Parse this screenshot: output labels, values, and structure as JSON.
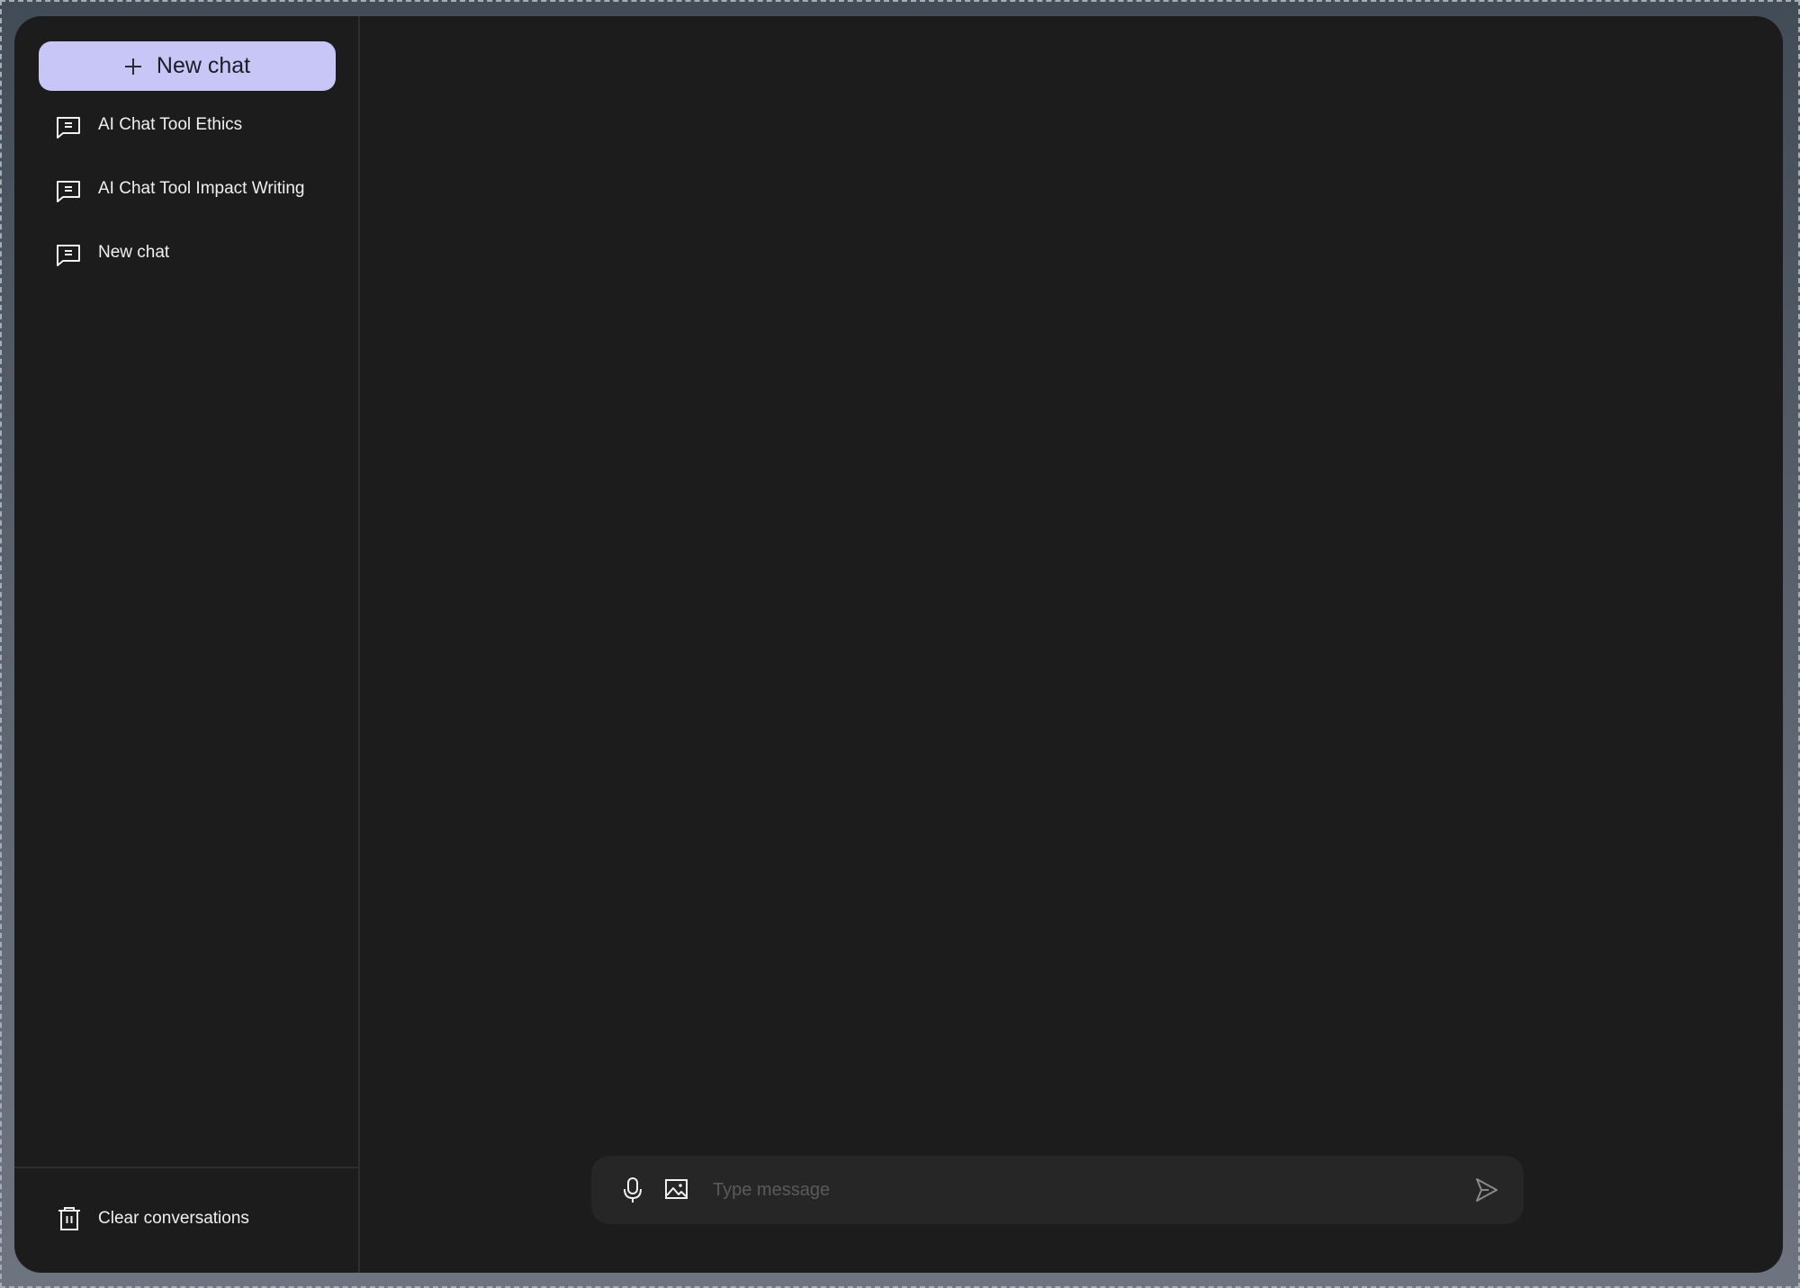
{
  "sidebar": {
    "new_chat_label": "New chat",
    "conversations": [
      {
        "title": "AI Chat Tool Ethics",
        "icon": "chat-bubble-icon"
      },
      {
        "title": "AI Chat Tool Impact Writing",
        "icon": "chat-bubble-icon"
      },
      {
        "title": "New chat",
        "icon": "chat-bubble-icon"
      }
    ],
    "clear_label": "Clear conversations"
  },
  "composer": {
    "placeholder": "Type message",
    "value": ""
  },
  "colors": {
    "accent": "#c8c6f6",
    "window_bg": "#1c1c1c",
    "composer_bg": "#262626"
  }
}
